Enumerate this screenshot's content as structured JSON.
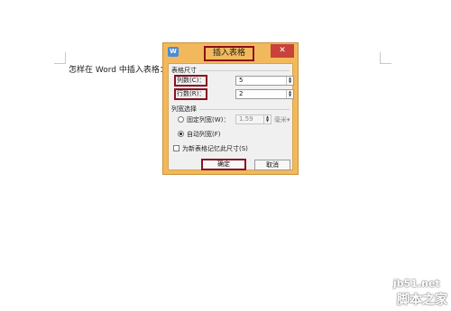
{
  "document": {
    "line_text": "怎样在 Word 中插入表格："
  },
  "dialog": {
    "app_icon": "W",
    "title": "插入表格",
    "close_glyph": "✕",
    "table_size": {
      "group_label": "表格尺寸",
      "columns_label": "列数(C)：",
      "columns_value": "5",
      "rows_label": "行数(R)：",
      "rows_value": "2"
    },
    "column_width": {
      "group_label": "列宽选择",
      "fixed_label": "固定列宽(W)：",
      "fixed_value": "1.59",
      "fixed_unit": "毫米▾",
      "auto_label": "自动列宽(F)",
      "selected": "auto"
    },
    "remember_label": "为新表格记忆此尺寸(S)",
    "ok_label": "确定",
    "cancel_label": "取消",
    "accent_color": "#8a1020",
    "frame_color": "#f2b95c"
  },
  "watermark": {
    "line1": "jb51.net",
    "line2": "脚本之家"
  }
}
